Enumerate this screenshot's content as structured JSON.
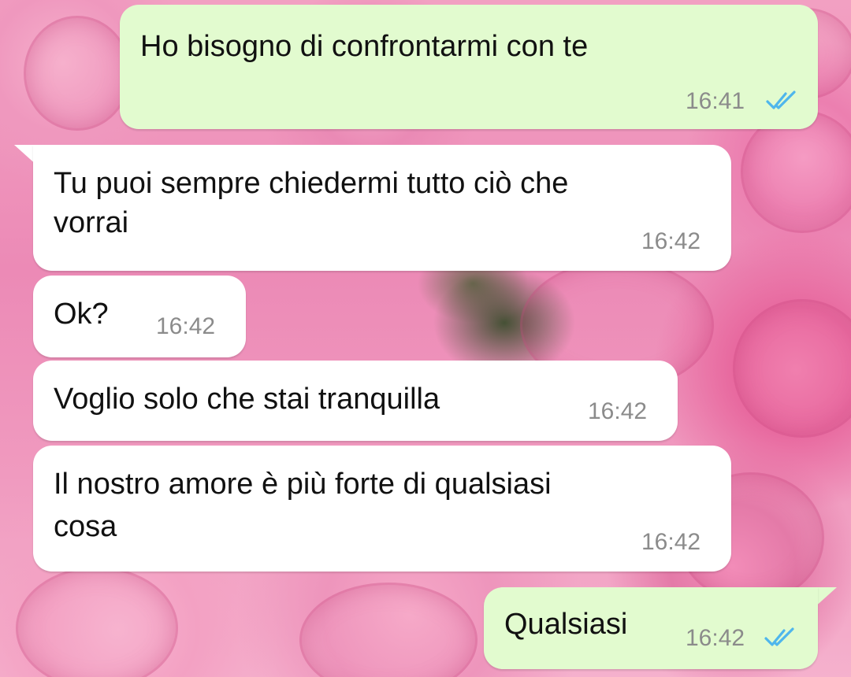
{
  "messages": [
    {
      "direction": "out",
      "text": "Ho bisogno di confrontarmi con te",
      "time": "16:41",
      "status": "read",
      "status_icon": "double-check-icon"
    },
    {
      "direction": "in",
      "text_lines": [
        "Tu puoi sempre chiedermi tutto ciò che",
        "vorrai"
      ],
      "time": "16:42"
    },
    {
      "direction": "in",
      "text": "Ok?",
      "time": "16:42"
    },
    {
      "direction": "in",
      "text": "Voglio solo che stai tranquilla",
      "time": "16:42"
    },
    {
      "direction": "in",
      "text_lines": [
        "Il nostro amore è più forte di qualsiasi",
        "cosa"
      ],
      "time": "16:42"
    },
    {
      "direction": "out",
      "text": "Qualsiasi",
      "time": "16:42",
      "status": "read",
      "status_icon": "double-check-icon"
    }
  ],
  "colors": {
    "outgoing_bubble": "#e2fbcf",
    "incoming_bubble": "#ffffff",
    "read_ticks": "#4fb6ec",
    "time_text": "#8b8b8b",
    "message_text": "#111111",
    "wallpaper": "#ec8ab6"
  },
  "wallpaper": "pink-roses-wallpaper"
}
